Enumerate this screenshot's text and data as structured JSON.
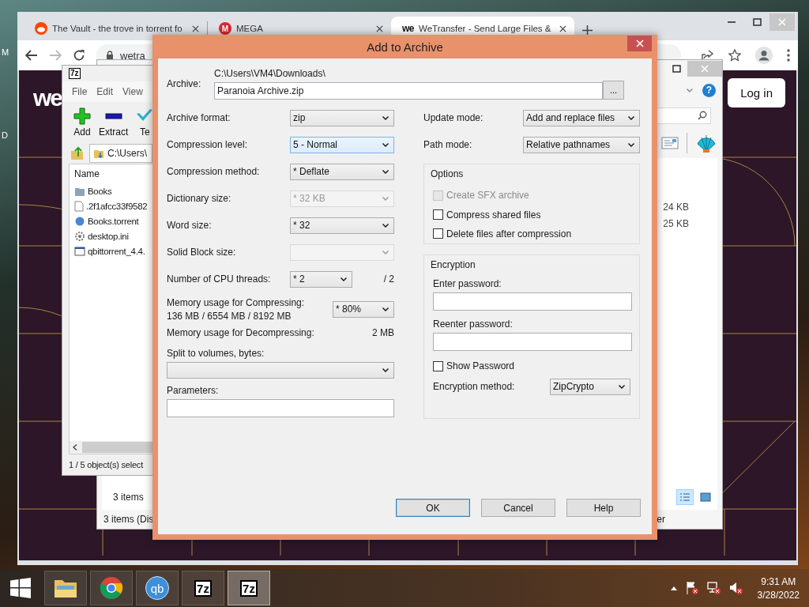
{
  "desktop": {
    "labels": [
      "M",
      "D"
    ]
  },
  "browser": {
    "tabs": [
      {
        "title": "The Vault - the trove in torrent fo",
        "kind": "reddit",
        "selected": false
      },
      {
        "title": "MEGA",
        "kind": "mega",
        "icon_text": "M",
        "selected": false
      },
      {
        "title": "WeTransfer - Send Large Files &",
        "kind": "wetransfer",
        "icon_text": "we",
        "selected": true
      }
    ],
    "address": "wetra",
    "page": {
      "logo": "we",
      "login_button": "Log in"
    }
  },
  "explorer": {
    "help": "?",
    "file_sizes": [
      "24 KB",
      "25 KB"
    ],
    "item_count": "3 items",
    "status_left": "3 items (Dis",
    "status_right": "er"
  },
  "file_manager": {
    "logo": "7z",
    "menu": [
      "File",
      "Edit",
      "View"
    ],
    "toolbar": [
      {
        "kind": "add",
        "label": "Add"
      },
      {
        "kind": "extract",
        "label": "Extract"
      },
      {
        "kind": "test",
        "label": "Te"
      }
    ],
    "path": "C:\\Users\\",
    "column": "Name",
    "files": [
      {
        "name": "Books",
        "kind": "folder"
      },
      {
        "name": ".2f1afcc33f9582",
        "kind": "file"
      },
      {
        "name": "Books.torrent",
        "kind": "torrent"
      },
      {
        "name": "desktop.ini",
        "kind": "settings"
      },
      {
        "name": "qbittorrent_4.4.",
        "kind": "program"
      }
    ],
    "status": "1 / 5 object(s) select"
  },
  "dialog": {
    "title": "Add to Archive",
    "archive_label": "Archive:",
    "archive_dir": "C:\\Users\\VM4\\Downloads\\",
    "archive_name": "Paranoia Archive.zip",
    "browse_button": "...",
    "left_rows": [
      {
        "kind": "select",
        "label": "Archive format:",
        "value": "zip",
        "focused": false,
        "disabled": false
      },
      {
        "kind": "select",
        "label": "Compression level:",
        "value": "5 - Normal",
        "focused": true,
        "disabled": false
      },
      {
        "kind": "select",
        "label": "Compression method:",
        "value": "* Deflate",
        "focused": false,
        "disabled": false
      },
      {
        "kind": "select",
        "label": "Dictionary size:",
        "value": "* 32 KB",
        "focused": false,
        "disabled": true
      },
      {
        "kind": "select",
        "label": "Word size:",
        "value": "* 32",
        "focused": false,
        "disabled": false
      },
      {
        "kind": "select",
        "label": "Solid Block size:",
        "focused": false,
        "disabled": true
      },
      {
        "kind": "select_total",
        "label": "Number of CPU threads:",
        "value": "* 2",
        "total": "/ 2",
        "focused": false,
        "disabled": false
      },
      {
        "kind": "memory",
        "label": "Memory usage for Compressing:",
        "detail": "136 MB / 6554 MB / 8192 MB",
        "value": "* 80%",
        "focused": false,
        "disabled": false
      },
      {
        "kind": "info",
        "label": "Memory usage for Decompressing:",
        "value": "2 MB"
      },
      {
        "kind": "combo",
        "label": "Split to volumes, bytes:"
      },
      {
        "kind": "text_field",
        "label": "Parameters:"
      }
    ],
    "right_rows": [
      {
        "label": "Update mode:",
        "value": "Add and replace files"
      },
      {
        "label": "Path mode:",
        "value": "Relative pathnames"
      }
    ],
    "options": {
      "title": "Options",
      "checkboxes": [
        {
          "label": "Create SFX archive",
          "checked": false,
          "disabled": true
        },
        {
          "label": "Compress shared files",
          "checked": false,
          "disabled": false
        },
        {
          "label": "Delete files after compression",
          "checked": false,
          "disabled": false
        }
      ]
    },
    "encryption": {
      "title": "Encryption",
      "password_label": "Enter password:",
      "reenter_label": "Reenter password:",
      "show_password": {
        "label": "Show Password",
        "checked": false
      },
      "method_label": "Encryption method:",
      "method": "ZipCrypto"
    },
    "buttons": [
      {
        "label": "OK",
        "default": true
      },
      {
        "label": "Cancel",
        "default": false
      },
      {
        "label": "Help",
        "default": false
      }
    ]
  },
  "taskbar": {
    "apps": [
      {
        "kind": "explorer",
        "selected": false
      },
      {
        "kind": "chrome",
        "selected": false
      },
      {
        "kind": "qbittorrent",
        "text": "qb",
        "selected": false
      },
      {
        "kind": "sevenzip",
        "text": "7z",
        "selected": false
      },
      {
        "kind": "sevenzip",
        "text": "7z",
        "selected": true
      }
    ],
    "time": "9:31 AM",
    "date": "3/28/2022"
  }
}
